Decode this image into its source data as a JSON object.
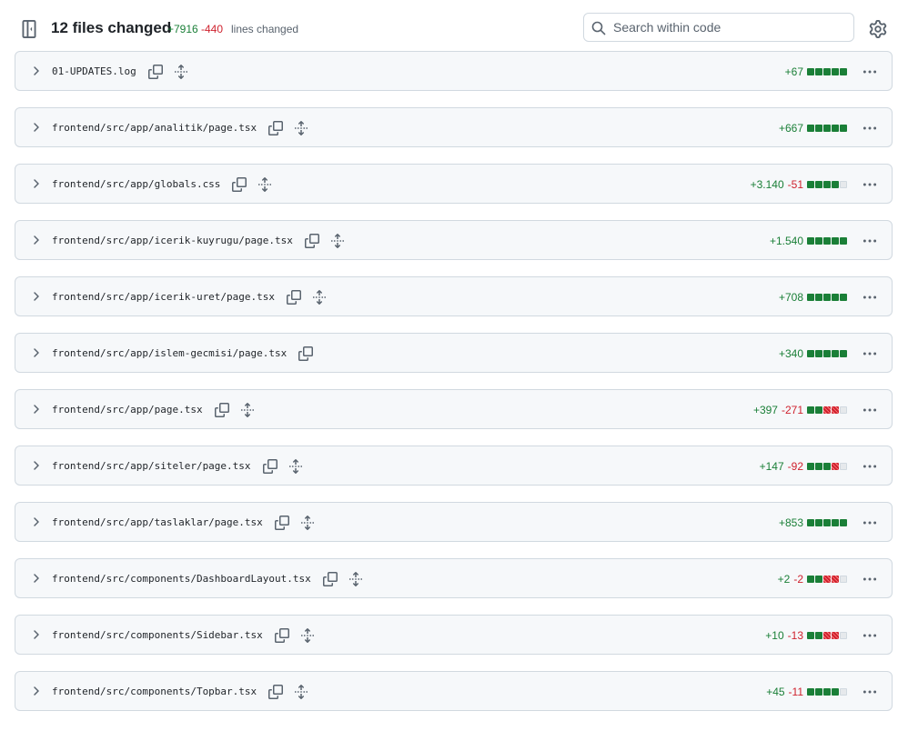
{
  "header": {
    "title": "12 files changed",
    "additions": "+7916",
    "deletions": "-440",
    "lines_label": "lines changed",
    "search_placeholder": "Search within code"
  },
  "colors": {
    "addition": "#1a7f37",
    "deletion": "#cf222e",
    "neutral": "#d1d9e0"
  },
  "icons": {
    "sidebar_toggle": "sidebar-collapse-icon",
    "search": "search-icon",
    "settings": "gear-icon",
    "row_expand": "chevron-right-icon",
    "copy": "copy-icon",
    "expand_all": "unfold-icon",
    "menu": "kebab-horizontal-icon"
  },
  "files": [
    {
      "path": "01-UPDATES.log",
      "additions": "+67",
      "deletions": "",
      "diffstat": [
        "a",
        "a",
        "a",
        "a",
        "a"
      ],
      "has_expand": true
    },
    {
      "path": "frontend/src/app/analitik/page.tsx",
      "additions": "+667",
      "deletions": "",
      "diffstat": [
        "a",
        "a",
        "a",
        "a",
        "a"
      ],
      "has_expand": true
    },
    {
      "path": "frontend/src/app/globals.css",
      "additions": "+3.140",
      "deletions": "-51",
      "diffstat": [
        "a",
        "a",
        "a",
        "a",
        "n"
      ],
      "has_expand": true
    },
    {
      "path": "frontend/src/app/icerik-kuyrugu/page.tsx",
      "additions": "+1.540",
      "deletions": "",
      "diffstat": [
        "a",
        "a",
        "a",
        "a",
        "a"
      ],
      "has_expand": true
    },
    {
      "path": "frontend/src/app/icerik-uret/page.tsx",
      "additions": "+708",
      "deletions": "",
      "diffstat": [
        "a",
        "a",
        "a",
        "a",
        "a"
      ],
      "has_expand": true
    },
    {
      "path": "frontend/src/app/islem-gecmisi/page.tsx",
      "additions": "+340",
      "deletions": "",
      "diffstat": [
        "a",
        "a",
        "a",
        "a",
        "a"
      ],
      "has_expand": false
    },
    {
      "path": "frontend/src/app/page.tsx",
      "additions": "+397",
      "deletions": "-271",
      "diffstat": [
        "a",
        "a",
        "d",
        "d",
        "n"
      ],
      "has_expand": true
    },
    {
      "path": "frontend/src/app/siteler/page.tsx",
      "additions": "+147",
      "deletions": "-92",
      "diffstat": [
        "a",
        "a",
        "a",
        "d",
        "n"
      ],
      "has_expand": true
    },
    {
      "path": "frontend/src/app/taslaklar/page.tsx",
      "additions": "+853",
      "deletions": "",
      "diffstat": [
        "a",
        "a",
        "a",
        "a",
        "a"
      ],
      "has_expand": true
    },
    {
      "path": "frontend/src/components/DashboardLayout.tsx",
      "additions": "+2",
      "deletions": "-2",
      "diffstat": [
        "a",
        "a",
        "d",
        "d",
        "n"
      ],
      "has_expand": true
    },
    {
      "path": "frontend/src/components/Sidebar.tsx",
      "additions": "+10",
      "deletions": "-13",
      "diffstat": [
        "a",
        "a",
        "d",
        "d",
        "n"
      ],
      "has_expand": true
    },
    {
      "path": "frontend/src/components/Topbar.tsx",
      "additions": "+45",
      "deletions": "-11",
      "diffstat": [
        "a",
        "a",
        "a",
        "a",
        "n"
      ],
      "has_expand": true
    }
  ]
}
